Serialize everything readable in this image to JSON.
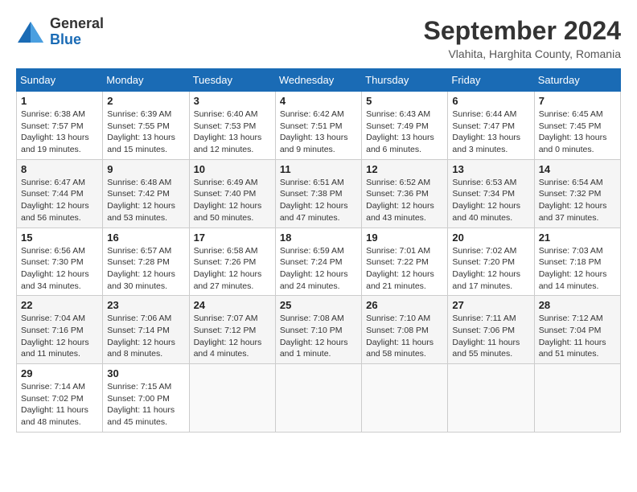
{
  "header": {
    "logo_general": "General",
    "logo_blue": "Blue",
    "month_title": "September 2024",
    "location": "Vlahita, Harghita County, Romania"
  },
  "columns": [
    "Sunday",
    "Monday",
    "Tuesday",
    "Wednesday",
    "Thursday",
    "Friday",
    "Saturday"
  ],
  "weeks": [
    [
      {
        "day": "1",
        "info": "Sunrise: 6:38 AM\nSunset: 7:57 PM\nDaylight: 13 hours and 19 minutes."
      },
      {
        "day": "2",
        "info": "Sunrise: 6:39 AM\nSunset: 7:55 PM\nDaylight: 13 hours and 15 minutes."
      },
      {
        "day": "3",
        "info": "Sunrise: 6:40 AM\nSunset: 7:53 PM\nDaylight: 13 hours and 12 minutes."
      },
      {
        "day": "4",
        "info": "Sunrise: 6:42 AM\nSunset: 7:51 PM\nDaylight: 13 hours and 9 minutes."
      },
      {
        "day": "5",
        "info": "Sunrise: 6:43 AM\nSunset: 7:49 PM\nDaylight: 13 hours and 6 minutes."
      },
      {
        "day": "6",
        "info": "Sunrise: 6:44 AM\nSunset: 7:47 PM\nDaylight: 13 hours and 3 minutes."
      },
      {
        "day": "7",
        "info": "Sunrise: 6:45 AM\nSunset: 7:45 PM\nDaylight: 13 hours and 0 minutes."
      }
    ],
    [
      {
        "day": "8",
        "info": "Sunrise: 6:47 AM\nSunset: 7:44 PM\nDaylight: 12 hours and 56 minutes."
      },
      {
        "day": "9",
        "info": "Sunrise: 6:48 AM\nSunset: 7:42 PM\nDaylight: 12 hours and 53 minutes."
      },
      {
        "day": "10",
        "info": "Sunrise: 6:49 AM\nSunset: 7:40 PM\nDaylight: 12 hours and 50 minutes."
      },
      {
        "day": "11",
        "info": "Sunrise: 6:51 AM\nSunset: 7:38 PM\nDaylight: 12 hours and 47 minutes."
      },
      {
        "day": "12",
        "info": "Sunrise: 6:52 AM\nSunset: 7:36 PM\nDaylight: 12 hours and 43 minutes."
      },
      {
        "day": "13",
        "info": "Sunrise: 6:53 AM\nSunset: 7:34 PM\nDaylight: 12 hours and 40 minutes."
      },
      {
        "day": "14",
        "info": "Sunrise: 6:54 AM\nSunset: 7:32 PM\nDaylight: 12 hours and 37 minutes."
      }
    ],
    [
      {
        "day": "15",
        "info": "Sunrise: 6:56 AM\nSunset: 7:30 PM\nDaylight: 12 hours and 34 minutes."
      },
      {
        "day": "16",
        "info": "Sunrise: 6:57 AM\nSunset: 7:28 PM\nDaylight: 12 hours and 30 minutes."
      },
      {
        "day": "17",
        "info": "Sunrise: 6:58 AM\nSunset: 7:26 PM\nDaylight: 12 hours and 27 minutes."
      },
      {
        "day": "18",
        "info": "Sunrise: 6:59 AM\nSunset: 7:24 PM\nDaylight: 12 hours and 24 minutes."
      },
      {
        "day": "19",
        "info": "Sunrise: 7:01 AM\nSunset: 7:22 PM\nDaylight: 12 hours and 21 minutes."
      },
      {
        "day": "20",
        "info": "Sunrise: 7:02 AM\nSunset: 7:20 PM\nDaylight: 12 hours and 17 minutes."
      },
      {
        "day": "21",
        "info": "Sunrise: 7:03 AM\nSunset: 7:18 PM\nDaylight: 12 hours and 14 minutes."
      }
    ],
    [
      {
        "day": "22",
        "info": "Sunrise: 7:04 AM\nSunset: 7:16 PM\nDaylight: 12 hours and 11 minutes."
      },
      {
        "day": "23",
        "info": "Sunrise: 7:06 AM\nSunset: 7:14 PM\nDaylight: 12 hours and 8 minutes."
      },
      {
        "day": "24",
        "info": "Sunrise: 7:07 AM\nSunset: 7:12 PM\nDaylight: 12 hours and 4 minutes."
      },
      {
        "day": "25",
        "info": "Sunrise: 7:08 AM\nSunset: 7:10 PM\nDaylight: 12 hours and 1 minute."
      },
      {
        "day": "26",
        "info": "Sunrise: 7:10 AM\nSunset: 7:08 PM\nDaylight: 11 hours and 58 minutes."
      },
      {
        "day": "27",
        "info": "Sunrise: 7:11 AM\nSunset: 7:06 PM\nDaylight: 11 hours and 55 minutes."
      },
      {
        "day": "28",
        "info": "Sunrise: 7:12 AM\nSunset: 7:04 PM\nDaylight: 11 hours and 51 minutes."
      }
    ],
    [
      {
        "day": "29",
        "info": "Sunrise: 7:14 AM\nSunset: 7:02 PM\nDaylight: 11 hours and 48 minutes."
      },
      {
        "day": "30",
        "info": "Sunrise: 7:15 AM\nSunset: 7:00 PM\nDaylight: 11 hours and 45 minutes."
      },
      null,
      null,
      null,
      null,
      null
    ]
  ]
}
